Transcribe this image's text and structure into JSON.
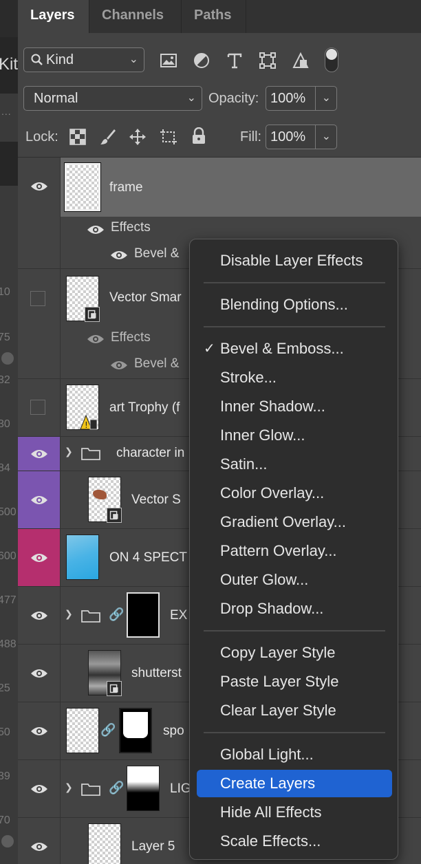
{
  "left_strip": {
    "kit_text": "Kit",
    "dots_text": "...",
    "numbers": [
      "10",
      "75",
      "32",
      "30",
      "84",
      "500",
      "600",
      "477",
      "488",
      "25",
      "50",
      "39",
      "70"
    ]
  },
  "tabs": [
    {
      "label": "Layers",
      "active": true
    },
    {
      "label": "Channels",
      "active": false
    },
    {
      "label": "Paths",
      "active": false
    }
  ],
  "filter": {
    "kind_label": "Kind",
    "icons": [
      "image-filter-icon",
      "adjustment-filter-icon",
      "type-filter-icon",
      "shape-filter-icon",
      "smart-object-filter-icon",
      "filter-toggle-icon"
    ]
  },
  "blend": {
    "mode": "Normal",
    "opacity_label": "Opacity:",
    "opacity_value": "100%"
  },
  "lock": {
    "label": "Lock:",
    "icons": [
      "lock-transparent-pixels-icon",
      "lock-image-pixels-icon",
      "lock-position-icon",
      "lock-artboard-icon",
      "lock-all-icon"
    ],
    "fill_label": "Fill:",
    "fill_value": "100%"
  },
  "layers": {
    "frame": {
      "name": "frame",
      "effects": "Effects",
      "effect_1": "Bevel &"
    },
    "vector_smart": {
      "name": "Vector Smar",
      "effects": "Effects",
      "effect_1": "Bevel &"
    },
    "art_trophy": {
      "name": "art Trophy (f"
    },
    "character_group": {
      "name": "character in"
    },
    "vector_s": {
      "name": "Vector S"
    },
    "on4": {
      "name": "ON 4 SPECT"
    },
    "ext_group": {
      "name": "EX"
    },
    "shutterstock": {
      "name": "shutterst"
    },
    "spot": {
      "name": "spo"
    },
    "light_group": {
      "name": "LIG"
    },
    "layer5": {
      "name": "Layer 5"
    }
  },
  "colors": {
    "purple_label": "#7b55b0",
    "magenta_label": "#b52f6e",
    "menu_highlight": "#1f63d2"
  },
  "context_menu": {
    "disable_effects": "Disable Layer Effects",
    "blending_options": "Blending Options...",
    "bevel_emboss": "Bevel & Emboss...",
    "bevel_check": "✓",
    "stroke": "Stroke...",
    "inner_shadow": "Inner Shadow...",
    "inner_glow": "Inner Glow...",
    "satin": "Satin...",
    "color_overlay": "Color Overlay...",
    "gradient_overlay": "Gradient Overlay...",
    "pattern_overlay": "Pattern Overlay...",
    "outer_glow": "Outer Glow...",
    "drop_shadow": "Drop Shadow...",
    "copy_style": "Copy Layer Style",
    "paste_style": "Paste Layer Style",
    "clear_style": "Clear Layer Style",
    "global_light": "Global Light...",
    "create_layers": "Create Layers",
    "hide_all_effects": "Hide All Effects",
    "scale_effects": "Scale Effects..."
  }
}
